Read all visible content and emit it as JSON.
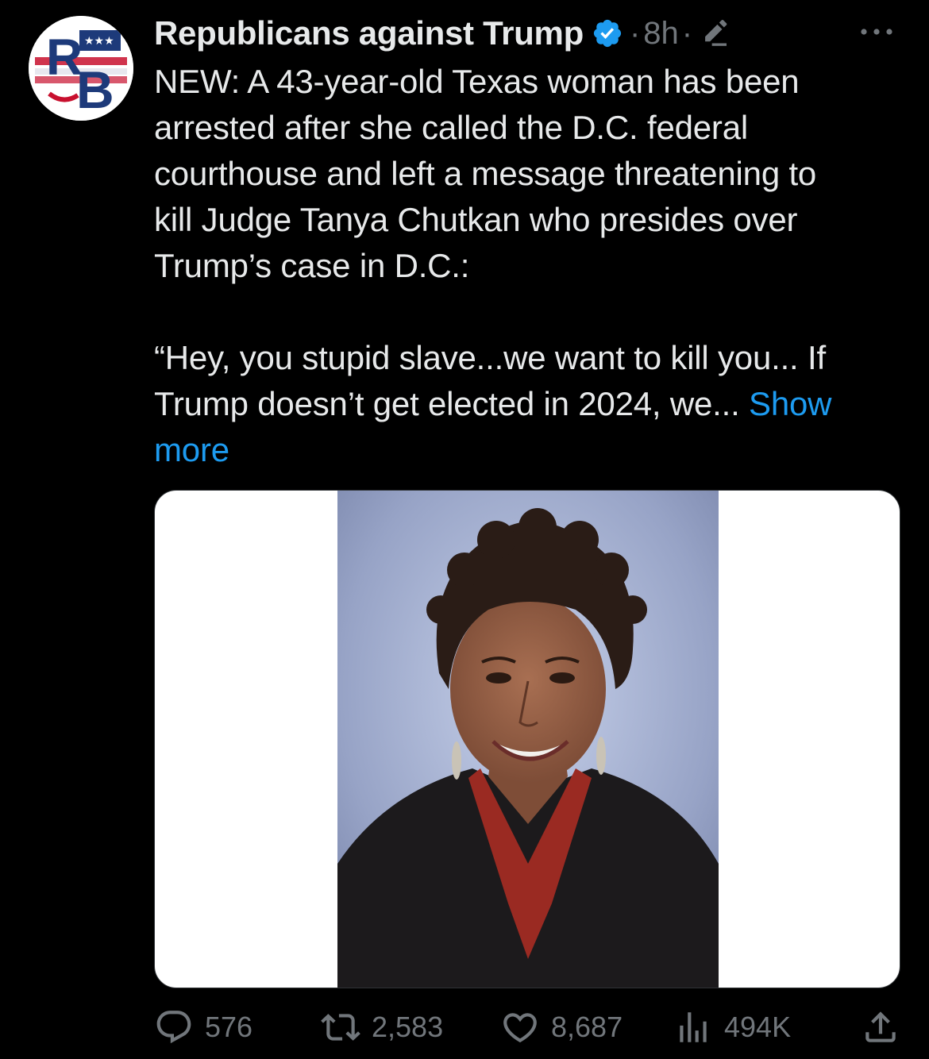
{
  "author": {
    "display_name": "Republicans against Trump",
    "verified_icon": "verified-badge-icon",
    "time": "8h",
    "separator": "·",
    "avatar_letters": "RB",
    "avatar_icon": "rb-logo-avatar"
  },
  "tweet": {
    "lines": [
      "NEW: A 43-year-old Texas woman has been",
      "arrested after she called the D.C. federal",
      "courthouse and left a message threatening to",
      "kill Judge Tanya Chutkan who presides over",
      "Trump’s case in D.C.:"
    ],
    "quote_line_1": "“Hey, you stupid slave...we want to kill you... If",
    "quote_line_2": "Trump doesn’t get elected in 2024, we...",
    "show_more_a": "Show",
    "show_more_b": "more"
  },
  "media": {
    "icon": "portrait-photo"
  },
  "actions": {
    "replies": "576",
    "retweets": "2,583",
    "likes": "8,687",
    "views": "494K"
  },
  "colors": {
    "background": "#000000",
    "text": "#e7e9ea",
    "muted": "#71767b",
    "link": "#1d9bf0"
  }
}
